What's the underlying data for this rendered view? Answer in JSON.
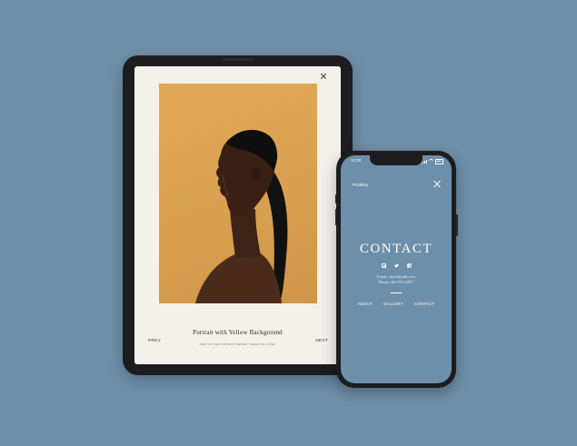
{
  "tablet": {
    "close_icon": "close-icon",
    "photo_title": "Portrait with Yellow Background",
    "photo_subtitle": "PART OF THE PORTRAIT SERIES. TAKEN JULY 2018.",
    "prev_label": "PREV",
    "next_label": "NEXT",
    "colors": {
      "screen_bg": "#f3f1ea",
      "photo_bg": "#dba253"
    }
  },
  "phone": {
    "status_time": "12:00",
    "brand": "PGallery",
    "title": "CONTACT",
    "social_icons": [
      "instagram-icon",
      "twitter-icon",
      "facebook-icon"
    ],
    "email": "Email: email@add.com",
    "phone": "Phone: 465-555-6877",
    "menu": [
      {
        "label": "ABOUT"
      },
      {
        "label": "GALLERY"
      },
      {
        "label": "CONTACT"
      }
    ],
    "colors": {
      "screen_bg": "#6d8fa9",
      "text": "#ffffff"
    }
  },
  "background_color": "#6f90a9"
}
